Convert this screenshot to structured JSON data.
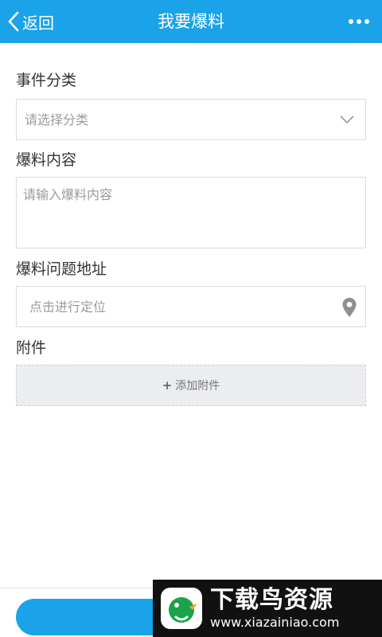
{
  "header": {
    "back_label": "返回",
    "title": "我要爆料"
  },
  "form": {
    "category": {
      "label": "事件分类",
      "placeholder": "请选择分类"
    },
    "content": {
      "label": "爆料内容",
      "placeholder": "请输入爆料内容"
    },
    "address": {
      "label": "爆料问题地址",
      "placeholder": "点击进行定位"
    },
    "attachment": {
      "label": "附件",
      "add_label": "添加附件"
    }
  },
  "watermark": {
    "name": "下载鸟资源",
    "url": "www.xiazainiao.com"
  },
  "colors": {
    "accent": "#1aa3e8",
    "background": "#ffffff"
  },
  "icons": [
    "chevron-left-icon",
    "more-dots-icon",
    "chevron-down-icon",
    "location-pin-icon",
    "plus-icon",
    "bird-logo-icon"
  ]
}
